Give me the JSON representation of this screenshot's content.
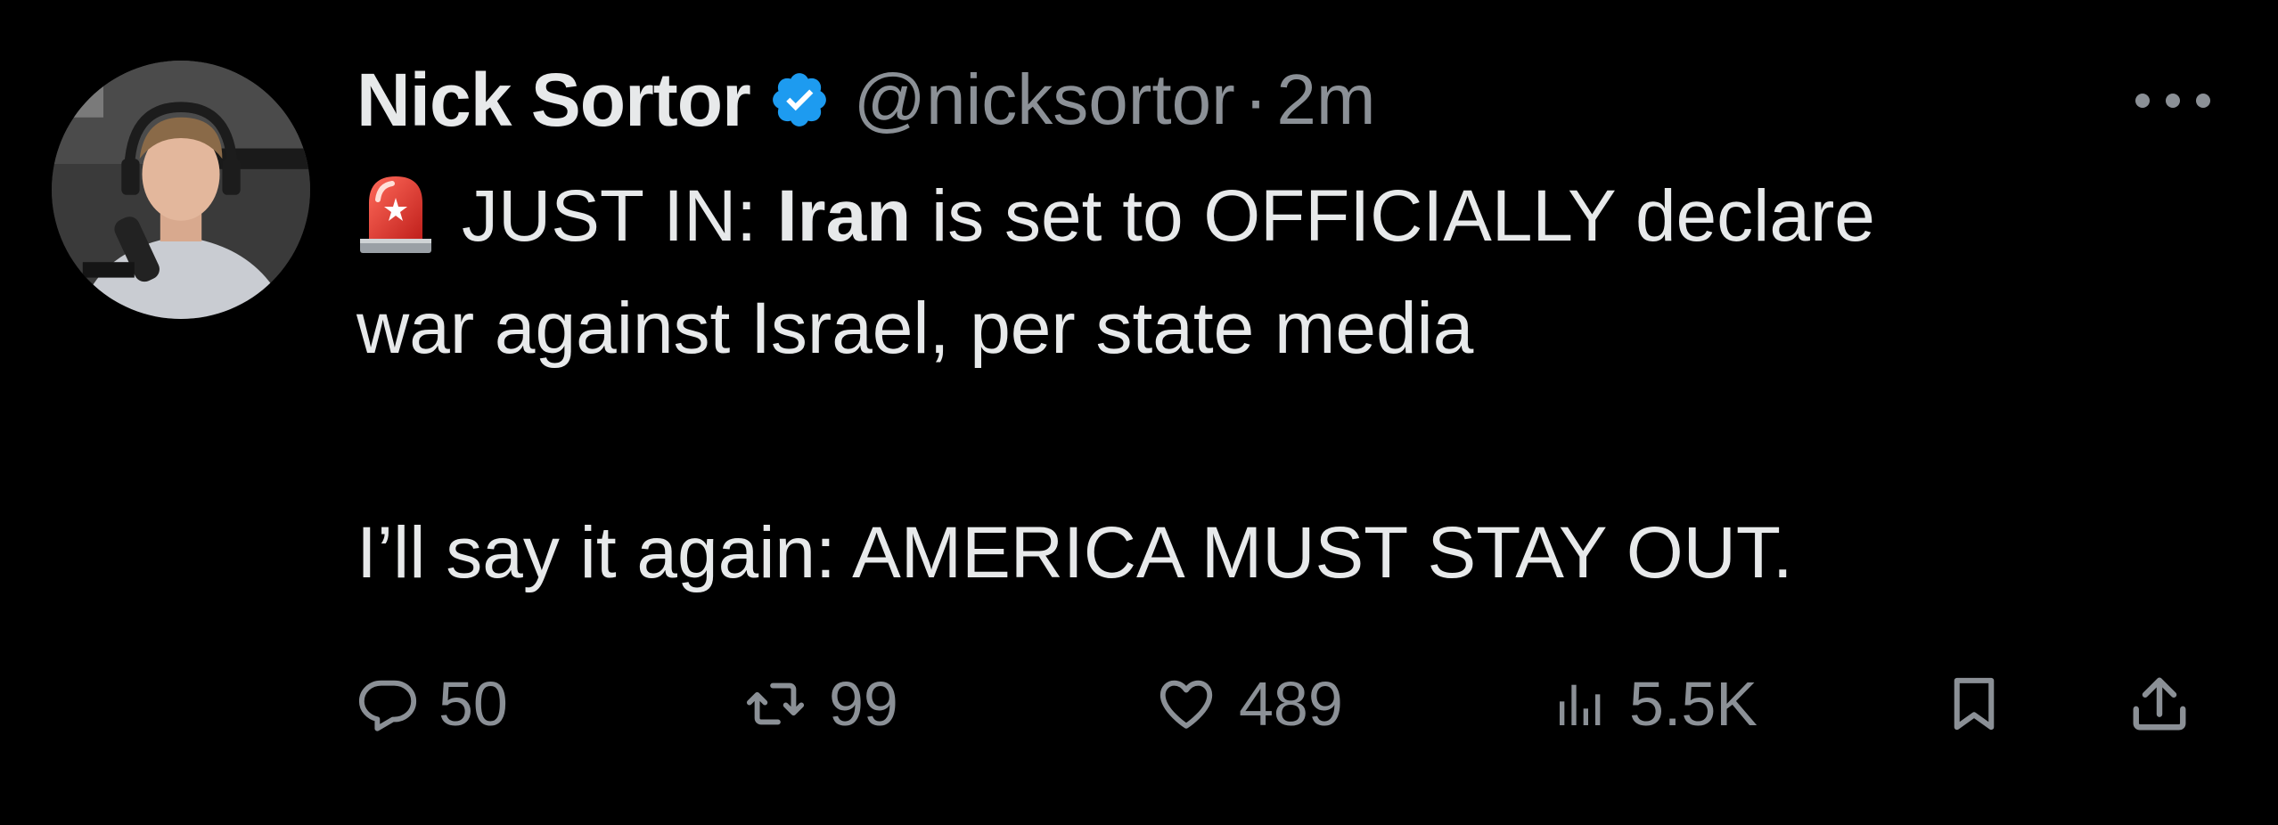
{
  "tweet": {
    "author": {
      "display_name": "Nick Sortor",
      "handle": "@nicksortor",
      "separator": "·",
      "time": "2m",
      "verified": true
    },
    "text": {
      "line1_prefix": "JUST IN: ",
      "line1_bold": "Iran",
      "line1_suffix": " is set to OFFICIALLY declare",
      "line2": "war against Israel, per state media",
      "line3": "I’ll say it again: AMERICA MUST STAY OUT."
    },
    "stats": {
      "replies": "50",
      "retweets": "99",
      "likes": "489",
      "views": "5.5K"
    }
  },
  "colors": {
    "background": "#000000",
    "text_primary": "#e7e9ea",
    "text_secondary": "#8b9096",
    "verified_blue": "#1d9bf0",
    "siren_red": "#e0302a"
  },
  "icons": {
    "verified": "verified-badge-icon",
    "more": "more-dots-icon",
    "siren": "police-siren-emoji",
    "reply": "reply-bubble-icon",
    "retweet": "retweet-arrows-icon",
    "like": "heart-icon",
    "views": "analytics-bars-icon",
    "bookmark": "bookmark-icon",
    "share": "share-upload-icon"
  }
}
